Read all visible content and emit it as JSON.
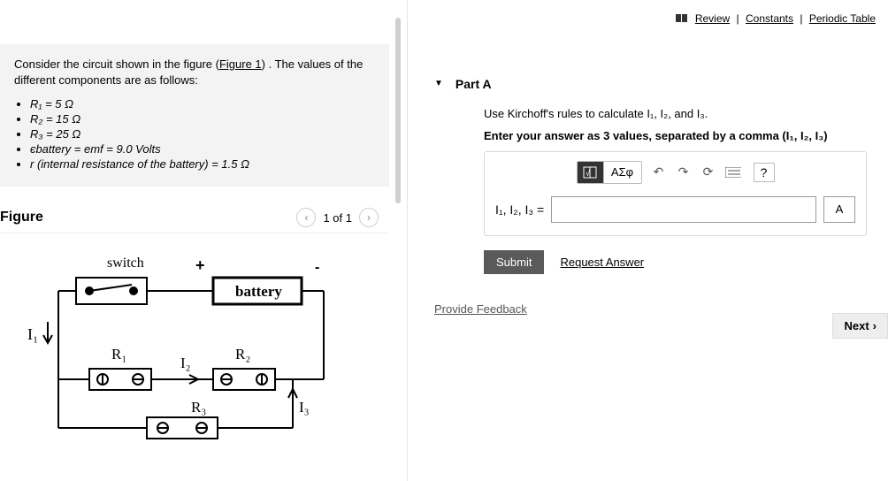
{
  "top_links": {
    "review": "Review",
    "constants": "Constants",
    "periodic": "Periodic Table"
  },
  "problem": {
    "intro_pre": "Consider the circuit shown in the figure (",
    "figure_link": "Figure 1",
    "intro_post": ") . The values of the different components are as follows:",
    "items": {
      "r1": "R₁ = 5 Ω",
      "r2": "R₂ = 15 Ω",
      "r3": "R₃ = 25 Ω",
      "emf": "єbattery  = emf =  9.0 Volts",
      "rint": "r (internal resistance of the battery) = 1.5 Ω"
    }
  },
  "figure": {
    "title": "Figure",
    "page": "1 of 1",
    "labels": {
      "switch": "switch",
      "plus": "+",
      "minus": "-",
      "battery": "battery",
      "I1": "I₁",
      "I2": "I₂",
      "I3": "I₃",
      "R1": "R₁",
      "R2": "R₂",
      "R3": "R₃"
    }
  },
  "part": {
    "title": "Part A",
    "question": "Use Kirchoff's rules to calculate I₁, I₂, and I₃.",
    "instruction": "Enter your answer as 3 values, separated by a comma (I₁, I₂, I₃)",
    "answer_label": "I₁, I₂, I₃ =",
    "unit": "A",
    "toolbar": {
      "greek": "ΑΣφ",
      "help": "?"
    },
    "submit": "Submit",
    "request": "Request Answer"
  },
  "feedback": "Provide Feedback",
  "next": "Next"
}
